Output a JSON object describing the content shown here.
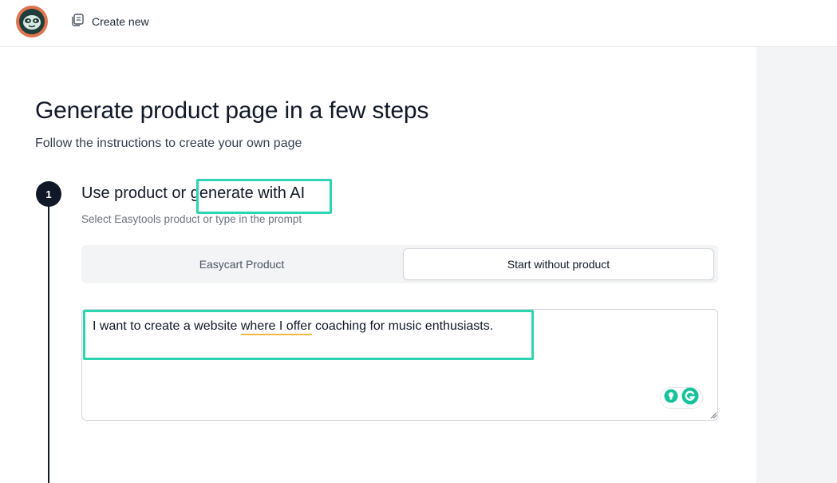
{
  "topbar": {
    "logo_name": "sloth-logo",
    "create_new_label": "Create new",
    "create_new_icon": "copy-icon"
  },
  "page": {
    "title": "Generate product page in a few steps",
    "subtitle": "Follow the instructions to create your own page"
  },
  "step1": {
    "number": "1",
    "heading_prefix": "Use product or ",
    "heading_highlight": "generate with AI",
    "description": "Select Easytools product or type in the prompt",
    "options": [
      {
        "label": "Easycart Product",
        "selected": false
      },
      {
        "label": "Start without product",
        "selected": true
      }
    ],
    "prompt": {
      "text_part1": "I want to create a website ",
      "text_underlined": "where I offer",
      "text_part2": " coaching for music enthusiasts."
    }
  },
  "colors": {
    "highlight": "#2dd4b0",
    "logo_orange": "#e0744f",
    "logo_dark": "#1f3d3a",
    "grammarly_green": "#15c39a",
    "underline": "#f4b942"
  }
}
